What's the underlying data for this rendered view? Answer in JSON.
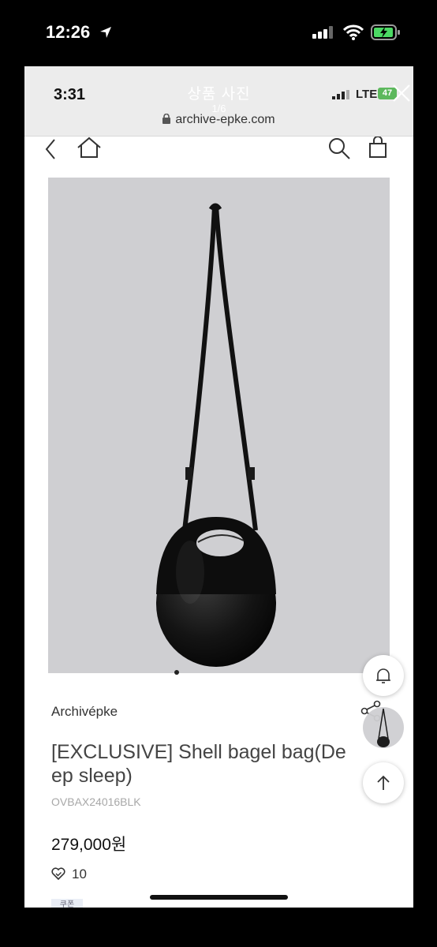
{
  "status_bar": {
    "time": "12:26",
    "location_icon": "location-arrow-icon",
    "signal_icon": "cellular-signal-icon",
    "wifi_icon": "wifi-icon",
    "battery_icon": "battery-charging-icon",
    "battery_color": "#4cd964"
  },
  "inner_screenshot": {
    "time": "3:31",
    "title": "상품 사진",
    "pager": "1/6",
    "url": "archive-epke.com",
    "network": "LTE",
    "battery": "47",
    "battery_color": "#5cb85c"
  },
  "nav": {
    "back_icon": "chevron-left-icon",
    "home_icon": "home-icon",
    "search_icon": "search-icon",
    "bag_icon": "shopping-bag-icon"
  },
  "product": {
    "brand": "Archivépke",
    "name": "[EXCLUSIVE] Shell bagel bag(Deep sleep)",
    "name_line1": "[EXCLUSIVE] Shell bagel bag(De",
    "name_line2": "ep sleep)",
    "code": "OVBAX24016BLK",
    "price": "279,000원",
    "likes": "10",
    "coupon": "쿠폰"
  },
  "floating_buttons": {
    "bell_icon": "bell-icon",
    "share_icon": "share-icon",
    "up_icon": "arrow-up-icon"
  }
}
